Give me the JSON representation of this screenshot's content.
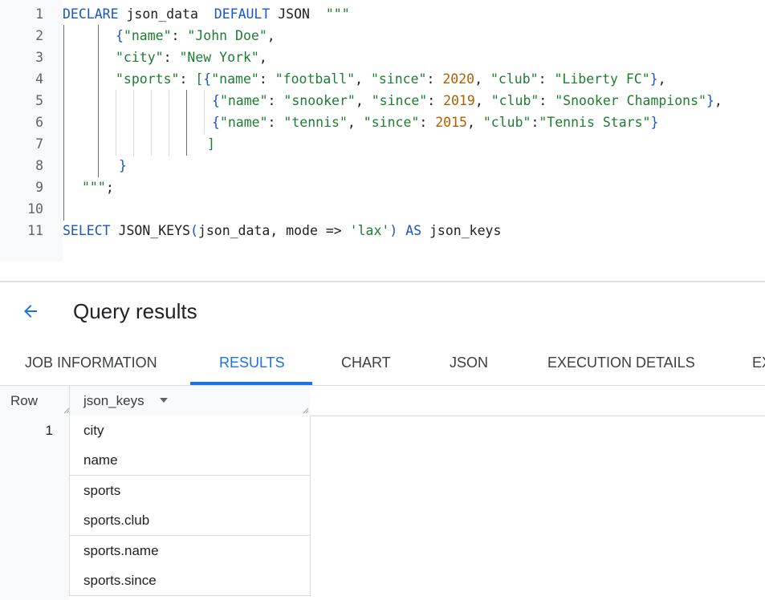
{
  "editor": {
    "lines": [
      {
        "n": "1",
        "tokens": [
          {
            "t": "DECLARE",
            "c": "kw"
          },
          {
            "t": " json_data  ",
            "c": "op"
          },
          {
            "t": "DEFAULT",
            "c": "kw"
          },
          {
            "t": " JSON  ",
            "c": "op"
          },
          {
            "t": "\"\"\"",
            "c": "str"
          }
        ]
      },
      {
        "n": "2",
        "tokens": [
          {
            "t": "{",
            "c": "kw"
          },
          {
            "t": "\"name\"",
            "c": "str"
          },
          {
            "t": ": ",
            "c": "op"
          },
          {
            "t": "\"John Doe\"",
            "c": "str"
          },
          {
            "t": ",",
            "c": "op"
          }
        ]
      },
      {
        "n": "3",
        "tokens": [
          {
            "t": "\"city\"",
            "c": "str"
          },
          {
            "t": ": ",
            "c": "op"
          },
          {
            "t": "\"New York\"",
            "c": "str"
          },
          {
            "t": ",",
            "c": "op"
          }
        ]
      },
      {
        "n": "4",
        "tokens": [
          {
            "t": "\"sports\"",
            "c": "str"
          },
          {
            "t": ": ",
            "c": "op"
          },
          {
            "t": "[",
            "c": "str"
          },
          {
            "t": "{",
            "c": "kw"
          },
          {
            "t": "\"name\"",
            "c": "str"
          },
          {
            "t": ": ",
            "c": "op"
          },
          {
            "t": "\"football\"",
            "c": "str"
          },
          {
            "t": ", ",
            "c": "op"
          },
          {
            "t": "\"since\"",
            "c": "str"
          },
          {
            "t": ": ",
            "c": "op"
          },
          {
            "t": "2020",
            "c": "num"
          },
          {
            "t": ", ",
            "c": "op"
          },
          {
            "t": "\"club\"",
            "c": "str"
          },
          {
            "t": ": ",
            "c": "op"
          },
          {
            "t": "\"Liberty FC\"",
            "c": "str"
          },
          {
            "t": "}",
            "c": "kw"
          },
          {
            "t": ",",
            "c": "op"
          }
        ]
      },
      {
        "n": "5",
        "tokens": [
          {
            "t": "{",
            "c": "kw"
          },
          {
            "t": "\"name\"",
            "c": "str"
          },
          {
            "t": ": ",
            "c": "op"
          },
          {
            "t": "\"snooker\"",
            "c": "str"
          },
          {
            "t": ", ",
            "c": "op"
          },
          {
            "t": "\"since\"",
            "c": "str"
          },
          {
            "t": ": ",
            "c": "op"
          },
          {
            "t": "2019",
            "c": "num"
          },
          {
            "t": ", ",
            "c": "op"
          },
          {
            "t": "\"club\"",
            "c": "str"
          },
          {
            "t": ": ",
            "c": "op"
          },
          {
            "t": "\"Snooker Champions\"",
            "c": "str"
          },
          {
            "t": "}",
            "c": "kw"
          },
          {
            "t": ",",
            "c": "op"
          }
        ]
      },
      {
        "n": "6",
        "tokens": [
          {
            "t": "{",
            "c": "kw"
          },
          {
            "t": "\"name\"",
            "c": "str"
          },
          {
            "t": ": ",
            "c": "op"
          },
          {
            "t": "\"tennis\"",
            "c": "str"
          },
          {
            "t": ", ",
            "c": "op"
          },
          {
            "t": "\"since\"",
            "c": "str"
          },
          {
            "t": ": ",
            "c": "op"
          },
          {
            "t": "2015",
            "c": "num"
          },
          {
            "t": ", ",
            "c": "op"
          },
          {
            "t": "\"club\"",
            "c": "str"
          },
          {
            "t": ":",
            "c": "op"
          },
          {
            "t": "\"Tennis Stars\"",
            "c": "str"
          },
          {
            "t": "}",
            "c": "kw"
          }
        ]
      },
      {
        "n": "7",
        "tokens": [
          {
            "t": "]",
            "c": "str"
          }
        ]
      },
      {
        "n": "8",
        "tokens": [
          {
            "t": "}",
            "c": "kw"
          }
        ]
      },
      {
        "n": "9",
        "tokens": [
          {
            "t": "\"\"\"",
            "c": "str"
          },
          {
            "t": ";",
            "c": "op"
          }
        ]
      },
      {
        "n": "10",
        "tokens": []
      },
      {
        "n": "11",
        "tokens": [
          {
            "t": "SELECT",
            "c": "kw"
          },
          {
            "t": " JSON_KEYS",
            "c": "op"
          },
          {
            "t": "(",
            "c": "kw"
          },
          {
            "t": "json_data, mode => ",
            "c": "op"
          },
          {
            "t": "'lax'",
            "c": "str"
          },
          {
            "t": ")",
            "c": "kw"
          },
          {
            "t": " ",
            "c": "op"
          },
          {
            "t": "AS",
            "c": "kw"
          },
          {
            "t": " json_keys",
            "c": "op"
          }
        ]
      }
    ]
  },
  "results": {
    "title": "Query results",
    "back_icon": "arrow-back-icon"
  },
  "tabs": [
    {
      "label": "JOB INFORMATION",
      "active": false
    },
    {
      "label": "RESULTS",
      "active": true
    },
    {
      "label": "CHART",
      "active": false
    },
    {
      "label": "JSON",
      "active": false
    },
    {
      "label": "EXECUTION DETAILS",
      "active": false
    },
    {
      "label": "EX",
      "active": false
    }
  ],
  "table": {
    "row_header": "Row",
    "column_header": "json_keys",
    "sort_icon": "arrow-drop-down-icon",
    "row_number": "1",
    "values": [
      "city",
      "name",
      "sports",
      "sports.club",
      "sports.name",
      "sports.since"
    ]
  },
  "colors": {
    "accent": "#1a73e8",
    "keyword": "#1a55c8",
    "string": "#1e7d32",
    "number": "#b35c00"
  }
}
